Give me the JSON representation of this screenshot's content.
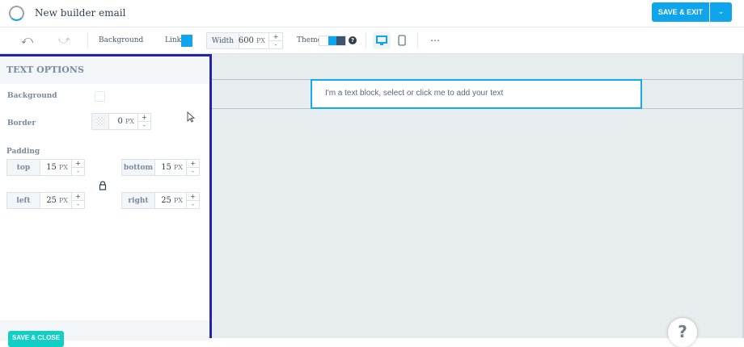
{
  "header": {
    "title": "New builder email",
    "save_exit": "SAVE & EXIT",
    "dropdown_glyph": "⌄"
  },
  "toolbar": {
    "undo": "⤺",
    "redo": "⤻",
    "background": "Background",
    "link": "Link",
    "link_color": "#0ea5ec",
    "width_label": "Width",
    "width_value": "600",
    "width_unit": "PX",
    "plus": "+",
    "minus": "-",
    "theme": "Theme",
    "help": "?",
    "more": "⋯"
  },
  "panel": {
    "title": "TEXT OPTIONS",
    "background_label": "Background",
    "border_label": "Border",
    "border_value": "0",
    "unit": "PX",
    "padding_label": "Padding",
    "padding": [
      {
        "label": "top",
        "value": "15"
      },
      {
        "label": "bottom",
        "value": "15"
      },
      {
        "label": "left",
        "value": "25"
      },
      {
        "label": "right",
        "value": "25"
      }
    ],
    "save_close": "SAVE & CLOSE"
  },
  "canvas": {
    "text_block": "I'm a text block, select or click me to add your text"
  },
  "help_button": "?"
}
